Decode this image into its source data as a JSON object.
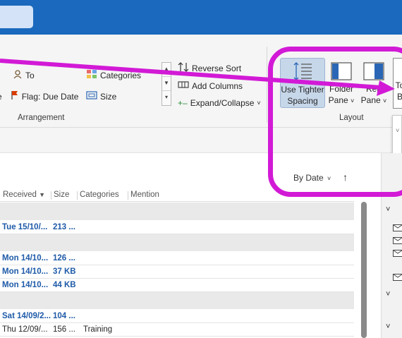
{
  "ribbon": {
    "to_label": "To",
    "categories_label": "Categories",
    "flag_due_date_label": "Flag: Due Date",
    "size_label": "Size",
    "reverse_sort_label": "Reverse Sort",
    "add_columns_label": "Add Columns",
    "expand_collapse_label": "Expand/Collapse",
    "arrangement_group_label": "Arrangement",
    "layout_group_label": "Layout",
    "use_tighter_spacing_line1": "Use Tighter",
    "use_tighter_spacing_line2": "Spacing",
    "folder_pane_line1": "Folder",
    "folder_pane_line2": "Pane",
    "reading_pane_line1": "Rea",
    "reading_pane_line2": "Pane",
    "todo_bar_line1": "To",
    "todo_bar_line2": "B"
  },
  "sort": {
    "by_label": "By Date",
    "arrow": "↑"
  },
  "columns": {
    "received": "Received",
    "size": "Size",
    "categories": "Categories",
    "mention": "Mention"
  },
  "rows": [
    {
      "received": "Tue 15/10/...",
      "size": "213 ...",
      "category": "",
      "unread": true
    },
    {
      "received": "Mon 14/10...",
      "size": "126 ...",
      "category": "",
      "unread": true
    },
    {
      "received": "Mon 14/10...",
      "size": "37 KB",
      "category": "",
      "unread": true
    },
    {
      "received": "Mon 14/10...",
      "size": "44 KB",
      "category": "",
      "unread": true
    },
    {
      "received": "Sat 14/09/2...",
      "size": "104 ...",
      "category": "",
      "unread": true
    },
    {
      "received": "Thu 12/09/...",
      "size": "156 ...",
      "category": "Training",
      "unread": false
    }
  ],
  "colors": {
    "accent_blue": "#1a69be",
    "unread_text": "#1e5aa8",
    "highlight_magenta": "#d21ad6",
    "flag_red": "#d83b01"
  }
}
